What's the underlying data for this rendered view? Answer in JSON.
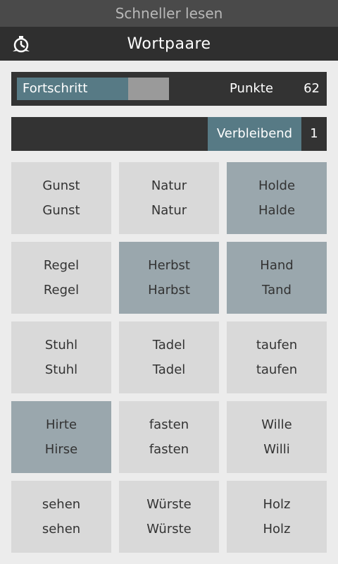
{
  "status_bar": {
    "title": "Schneller lesen"
  },
  "action_bar": {
    "title": "Wortpaare",
    "icon": "timer-icon"
  },
  "progress": {
    "label": "Fortschritt",
    "fraction": 0.73
  },
  "score": {
    "label": "Punkte",
    "value": "62"
  },
  "remaining": {
    "label": "Verbleibend",
    "value": "1"
  },
  "colors": {
    "accent": "#577a85",
    "tile": "#d9d9d9",
    "tile_selected": "#9aa7ad",
    "panel": "#333333"
  },
  "tiles": [
    {
      "word1": "Gunst",
      "word2": "Gunst",
      "selected": false
    },
    {
      "word1": "Natur",
      "word2": "Natur",
      "selected": false
    },
    {
      "word1": "Holde",
      "word2": "Halde",
      "selected": true
    },
    {
      "word1": "Regel",
      "word2": "Regel",
      "selected": false
    },
    {
      "word1": "Herbst",
      "word2": "Harbst",
      "selected": true
    },
    {
      "word1": "Hand",
      "word2": "Tand",
      "selected": true
    },
    {
      "word1": "Stuhl",
      "word2": "Stuhl",
      "selected": false
    },
    {
      "word1": "Tadel",
      "word2": "Tadel",
      "selected": false
    },
    {
      "word1": "taufen",
      "word2": "taufen",
      "selected": false
    },
    {
      "word1": "Hirte",
      "word2": "Hirse",
      "selected": true
    },
    {
      "word1": "fasten",
      "word2": "fasten",
      "selected": false
    },
    {
      "word1": "Wille",
      "word2": "Willi",
      "selected": false
    },
    {
      "word1": "sehen",
      "word2": "sehen",
      "selected": false
    },
    {
      "word1": "Würste",
      "word2": "Würste",
      "selected": false
    },
    {
      "word1": "Holz",
      "word2": "Holz",
      "selected": false
    }
  ]
}
